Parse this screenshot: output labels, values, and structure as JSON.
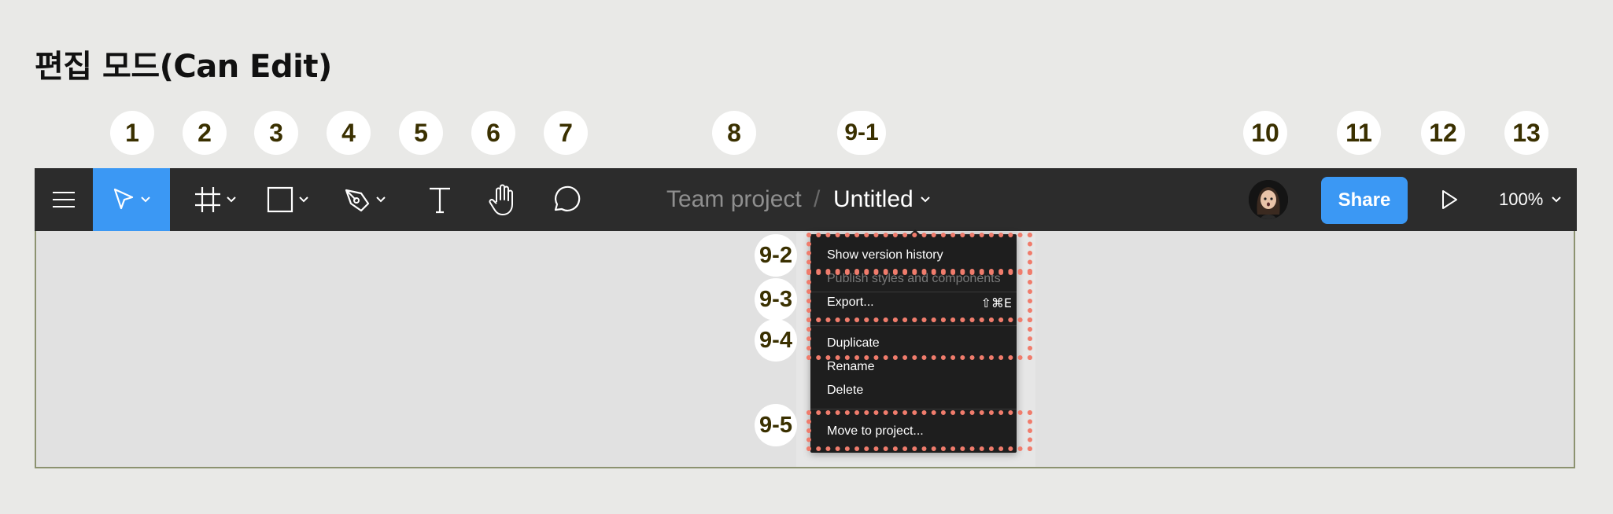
{
  "title": "편집 모드(Can Edit)",
  "badges": {
    "b1": "1",
    "b2": "2",
    "b3": "3",
    "b4": "4",
    "b5": "5",
    "b6": "6",
    "b7": "7",
    "b8": "8",
    "b9_1": "9-1",
    "b10": "10",
    "b11": "11",
    "b12": "12",
    "b13": "13"
  },
  "toolbar": {
    "menu_icon": "hamburger-icon",
    "move_tool_icon": "cursor-arrow-icon",
    "frame_tool_icon": "frame-hash-icon",
    "shape_tool_icon": "rectangle-icon",
    "pen_tool_icon": "pen-icon",
    "text_tool_icon": "text-icon",
    "hand_tool_icon": "hand-icon",
    "comment_tool_icon": "comment-bubble-icon",
    "active_color": "#3b98f4",
    "background_color": "#2c2c2c"
  },
  "breadcrumb": {
    "project": "Team project",
    "separator": "/",
    "file": "Untitled"
  },
  "right": {
    "share_label": "Share",
    "present_icon": "play-icon",
    "zoom": "100%"
  },
  "file_menu": {
    "items": [
      {
        "label": "Show version history"
      },
      {
        "label": "Publish styles and components",
        "disabled": true
      },
      {
        "label": "Export...",
        "shortcut": "⇧⌘E"
      },
      {
        "label": "Duplicate"
      },
      {
        "label": "Rename"
      },
      {
        "label": "Delete"
      },
      {
        "label": "Move to project..."
      }
    ]
  },
  "sub_badges": {
    "s2": "9-2",
    "s3": "9-3",
    "s4": "9-4",
    "s5": "9-5"
  },
  "highlight_color": "#f07c6c"
}
